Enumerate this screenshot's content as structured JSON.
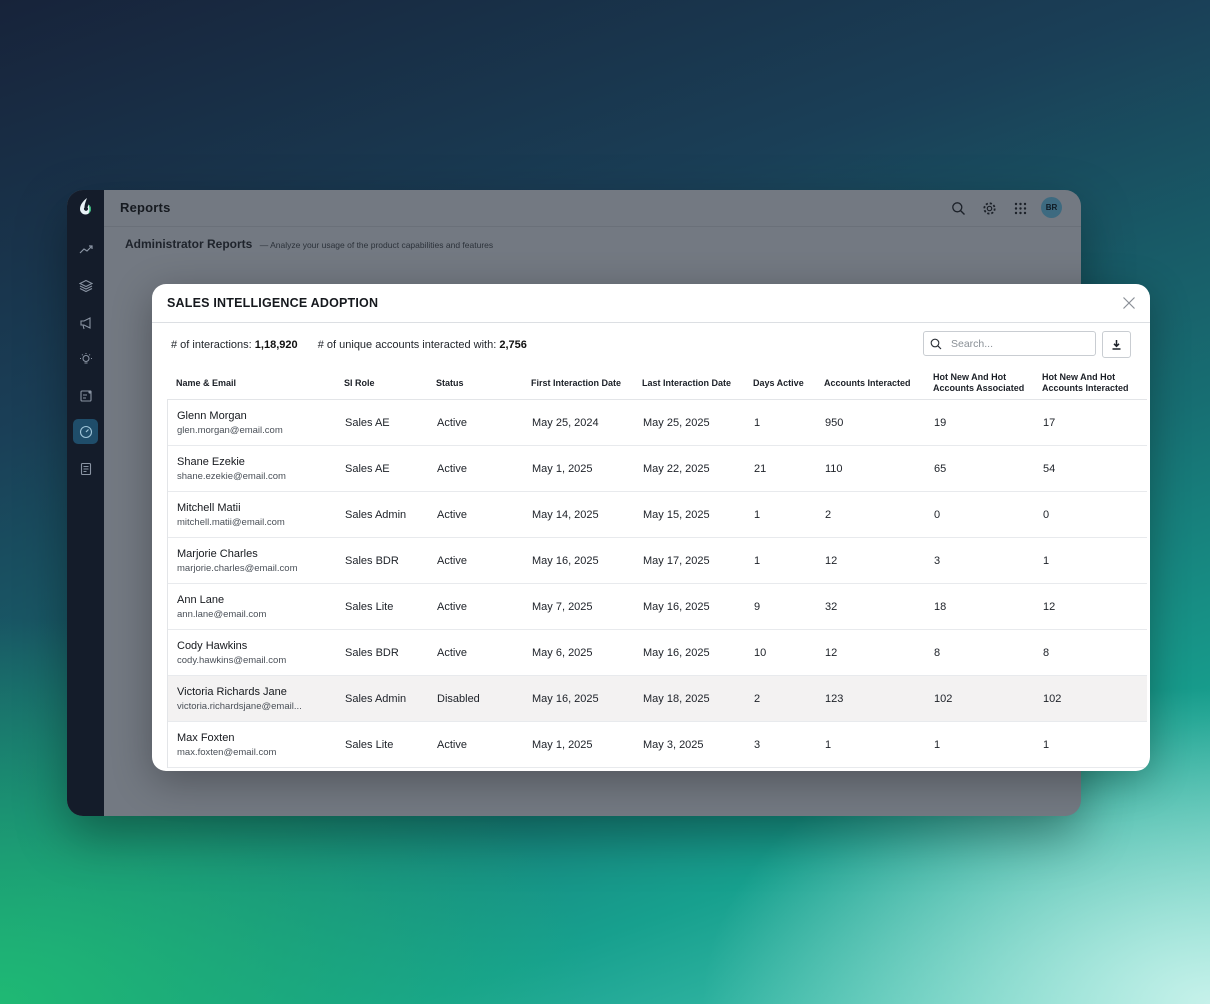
{
  "app": {
    "title": "Reports",
    "avatar_initials": "BR",
    "subheading": "Administrator Reports",
    "subheading_desc": "— Analyze your usage of the product capabilities and features",
    "sidebar_icons": [
      "trend-icon",
      "layers-icon",
      "megaphone-icon",
      "lightbulb-icon",
      "checklist-icon",
      "gauge-icon",
      "notes-icon"
    ],
    "accent": "#1f4d6a"
  },
  "modal": {
    "title": "SALES INTELLIGENCE ADOPTION",
    "stats": {
      "interactions_label": "# of interactions:",
      "interactions_value": "1,18,920",
      "accounts_label": "# of unique accounts interacted with:",
      "accounts_value": "2,756"
    },
    "search_placeholder": "Search...",
    "columns": {
      "name": "Name & Email",
      "role": "SI Role",
      "status": "Status",
      "first": "First Interaction Date",
      "last": "Last Interaction Date",
      "days": "Days Active",
      "accounts": "Accounts Interacted",
      "hot_assoc": "Hot New And Hot Accounts Associated",
      "hot_inter": "Hot New And Hot Accounts Interacted"
    },
    "rows": [
      {
        "name": "Glenn Morgan",
        "email": "glen.morgan@email.com",
        "role": "Sales AE",
        "status": "Active",
        "first": "May 25, 2024",
        "last": "May 25, 2025",
        "days": "1",
        "accounts": "950",
        "hot_assoc": "19",
        "hot_inter": "17"
      },
      {
        "name": "Shane Ezekie",
        "email": "shane.ezekie@email.com",
        "role": "Sales AE",
        "status": "Active",
        "first": "May 1, 2025",
        "last": "May 22, 2025",
        "days": "21",
        "accounts": "110",
        "hot_assoc": "65",
        "hot_inter": "54"
      },
      {
        "name": "Mitchell Matii",
        "email": "mitchell.matii@email.com",
        "role": "Sales Admin",
        "status": "Active",
        "first": "May 14, 2025",
        "last": "May 15, 2025",
        "days": "1",
        "accounts": "2",
        "hot_assoc": "0",
        "hot_inter": "0"
      },
      {
        "name": "Marjorie Charles",
        "email": "marjorie.charles@email.com",
        "role": "Sales BDR",
        "status": "Active",
        "first": "May 16, 2025",
        "last": "May 17, 2025",
        "days": "1",
        "accounts": "12",
        "hot_assoc": "3",
        "hot_inter": "1"
      },
      {
        "name": "Ann Lane",
        "email": "ann.lane@email.com",
        "role": "Sales Lite",
        "status": "Active",
        "first": "May 7, 2025",
        "last": "May 16, 2025",
        "days": "9",
        "accounts": "32",
        "hot_assoc": "18",
        "hot_inter": "12"
      },
      {
        "name": "Cody Hawkins",
        "email": "cody.hawkins@email.com",
        "role": "Sales BDR",
        "status": "Active",
        "first": "May 6, 2025",
        "last": "May 16, 2025",
        "days": "10",
        "accounts": "12",
        "hot_assoc": "8",
        "hot_inter": "8"
      },
      {
        "name": "Victoria Richards Jane",
        "email": "victoria.richardsjane@email...",
        "role": "Sales Admin",
        "status": "Disabled",
        "first": "May 16, 2025",
        "last": "May 18, 2025",
        "days": "2",
        "accounts": "123",
        "hot_assoc": "102",
        "hot_inter": "102"
      },
      {
        "name": "Max Foxten",
        "email": "max.foxten@email.com",
        "role": "Sales Lite",
        "status": "Active",
        "first": "May 1, 2025",
        "last": "May 3, 2025",
        "days": "3",
        "accounts": "1",
        "hot_assoc": "1",
        "hot_inter": "1"
      }
    ]
  }
}
